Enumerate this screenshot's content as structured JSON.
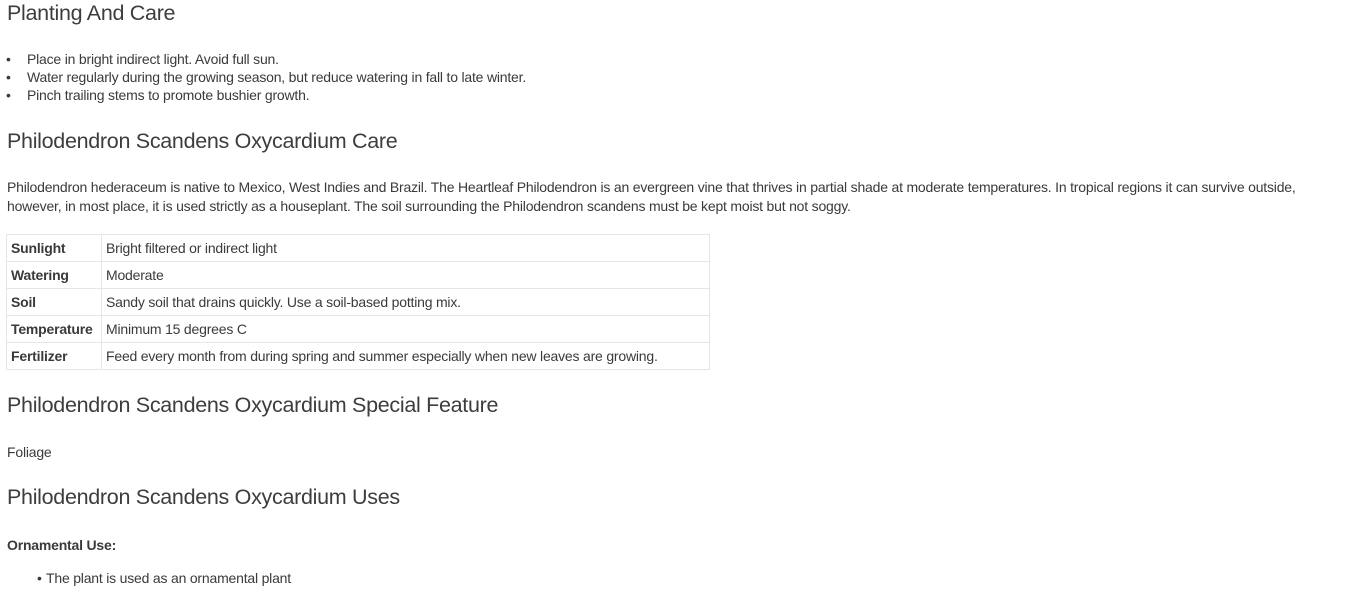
{
  "sections": [
    {
      "title": "Planting And Care",
      "bullets": [
        "Place in bright indirect light. Avoid full sun.",
        "Water regularly during the growing season, but reduce watering in fall to late winter.",
        "Pinch trailing stems to promote bushier growth."
      ]
    },
    {
      "title": "Philodendron Scandens Oxycardium Care",
      "paragraph": "Philodendron hederaceum is native to Mexico, West Indies and Brazil. The Heartleaf Philodendron is an evergreen vine that thrives in partial shade at moderate temperatures. In tropical regions it can survive outside, however, in most place, it is used strictly as a houseplant. The soil surrounding the Philodendron scandens must be kept moist but not soggy.",
      "table": [
        [
          "Sunlight",
          "Bright filtered or indirect light"
        ],
        [
          "Watering",
          "Moderate"
        ],
        [
          "Soil",
          "Sandy soil that drains quickly. Use a soil-based potting mix."
        ],
        [
          "Temperature",
          "Minimum 15 degrees C"
        ],
        [
          "Fertilizer",
          "Feed every month from during spring and summer especially when new leaves are growing."
        ]
      ]
    },
    {
      "title": "Philodendron Scandens Oxycardium Special Feature",
      "paragraph": "Foliage"
    },
    {
      "title": "Philodendron Scandens Oxycardium Uses",
      "subheading": "Ornamental Use:",
      "bullets": [
        "The plant is used as an ornamental plant"
      ]
    }
  ]
}
